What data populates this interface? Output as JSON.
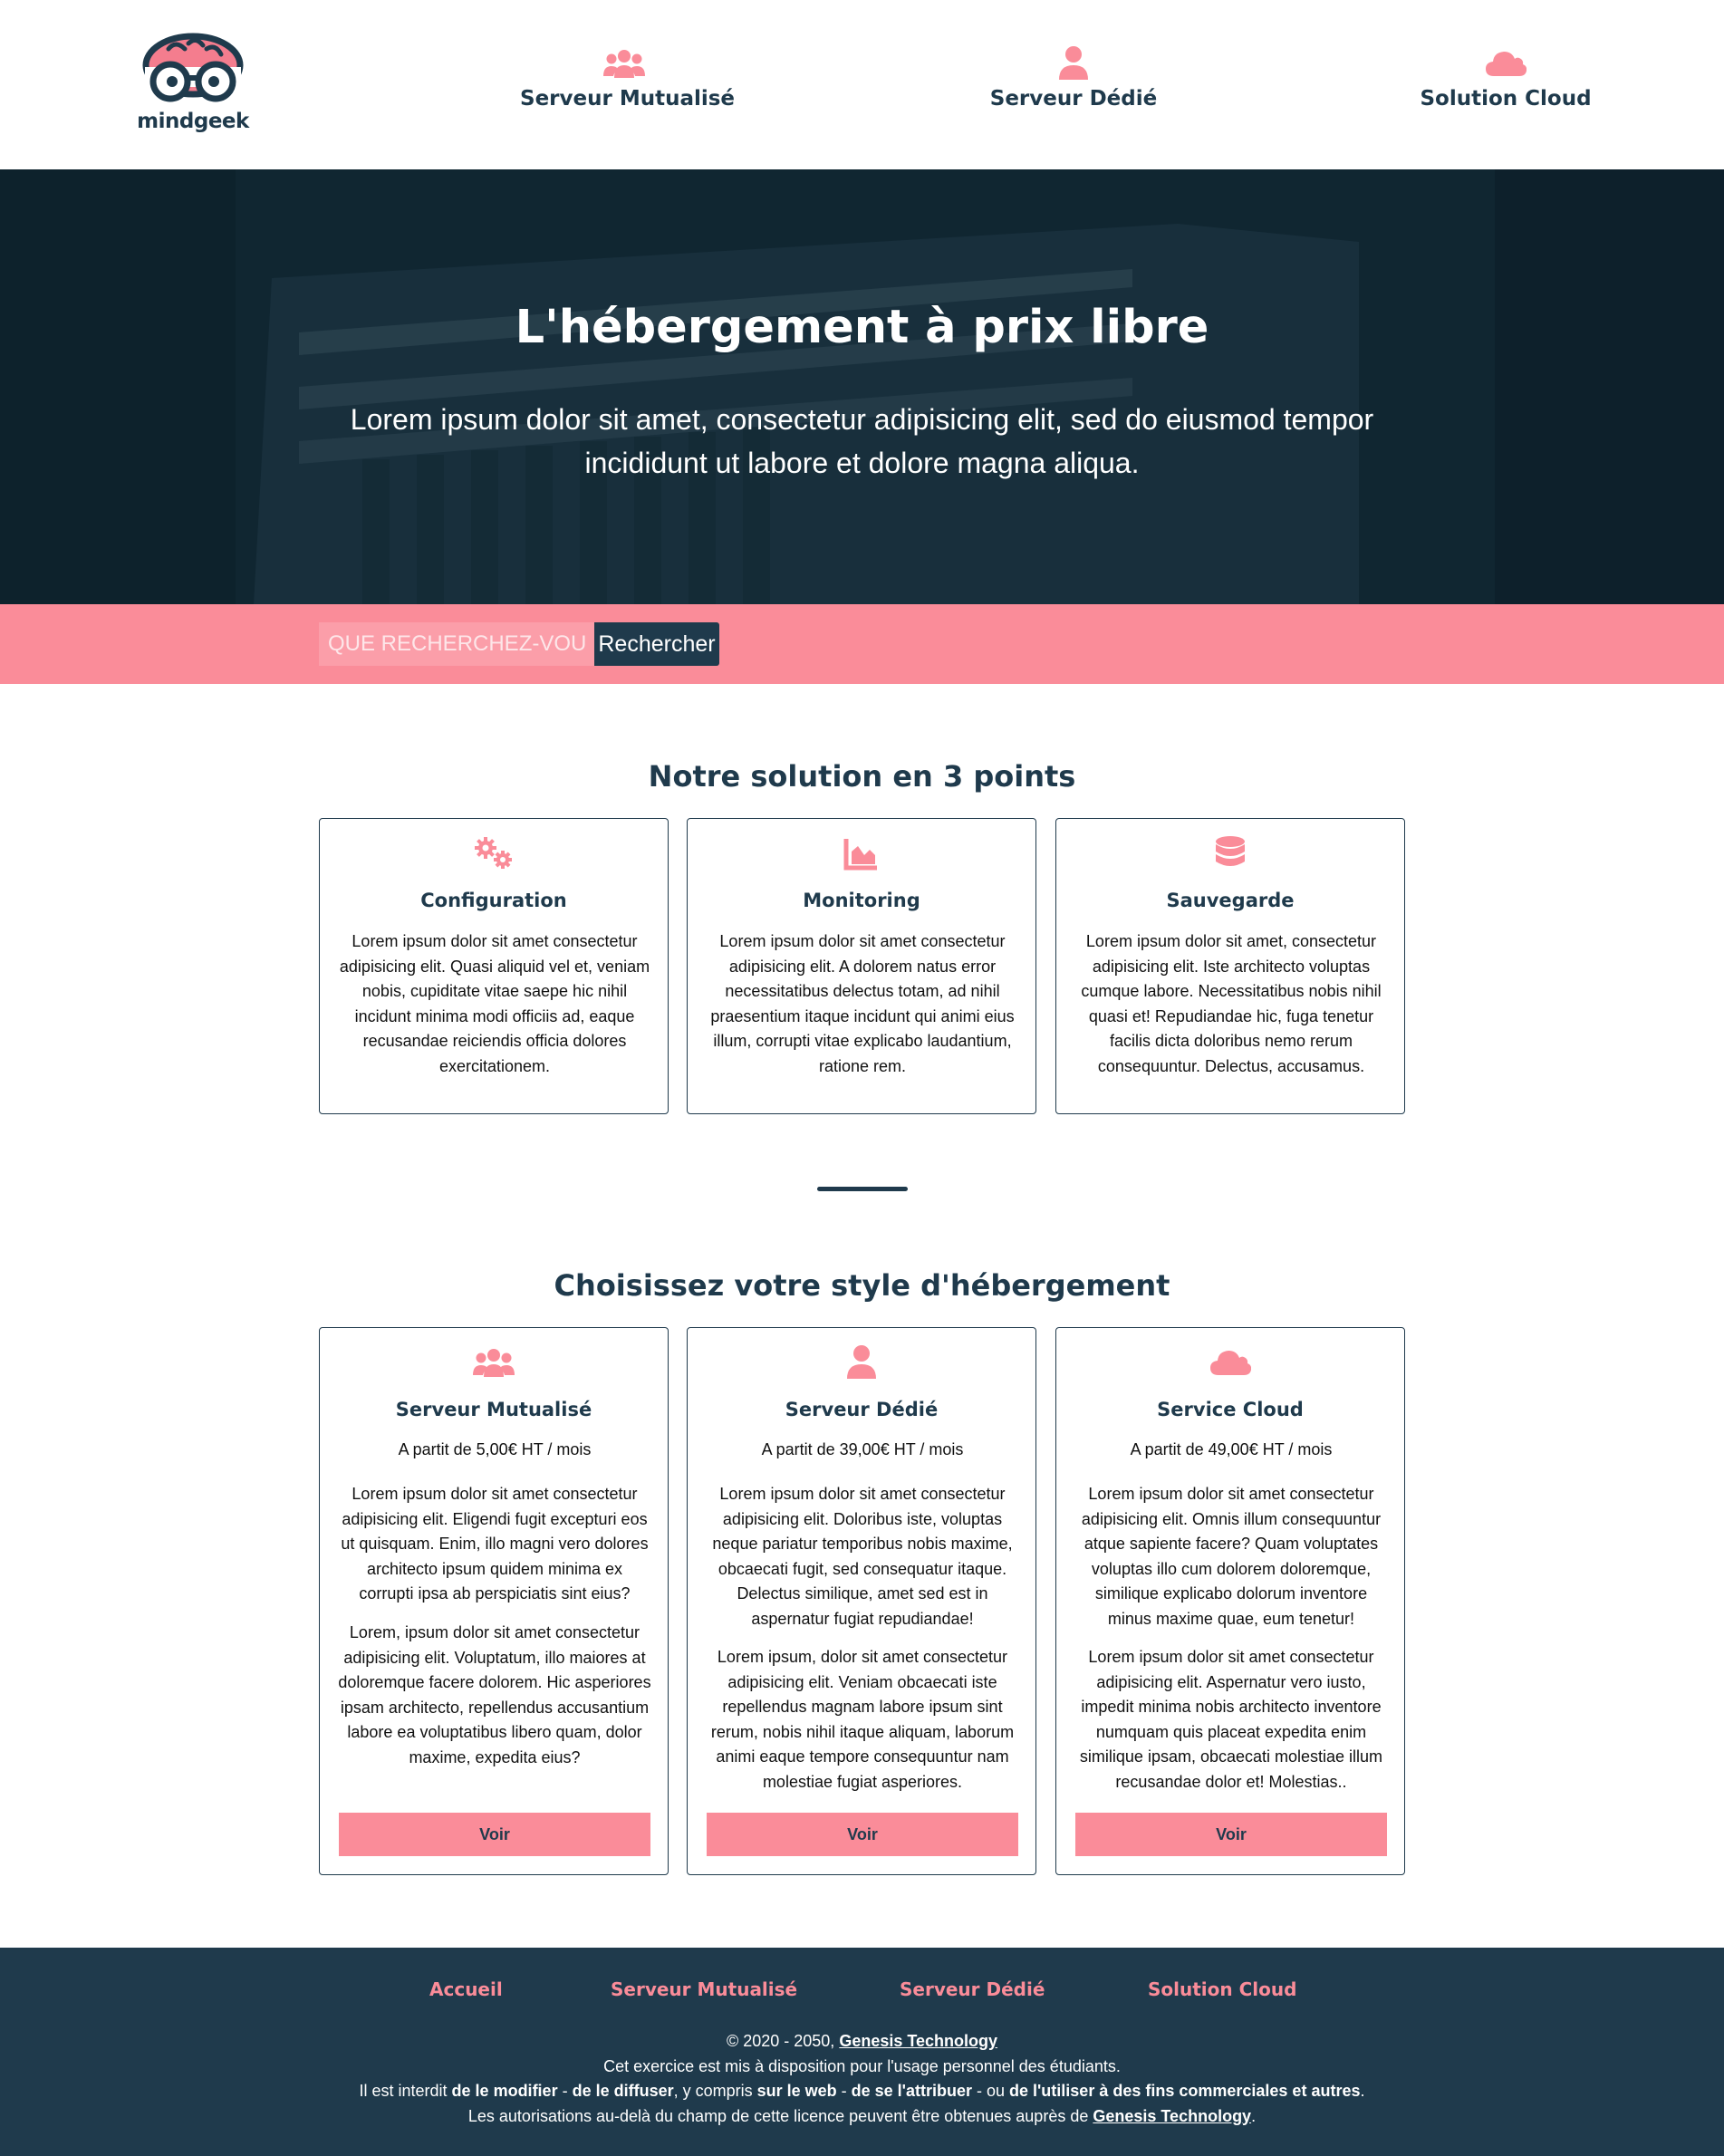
{
  "brand": {
    "name": "mindgeek",
    "primary": "#1f3a4c",
    "accent": "#fa8c99"
  },
  "nav": {
    "items": [
      {
        "label": "Serveur Mutualisé",
        "icon": "users-icon"
      },
      {
        "label": "Serveur Dédié",
        "icon": "user-icon"
      },
      {
        "label": "Solution Cloud",
        "icon": "cloud-icon"
      }
    ]
  },
  "hero": {
    "title": "L'hébergement à prix libre",
    "subtitle": "Lorem ipsum dolor sit amet, consectetur adipisicing elit, sed do eiusmod tempor incididunt ut labore et dolore magna aliqua."
  },
  "search": {
    "placeholder": "QUE RECHERCHEZ-VOUS ?",
    "button": "Rechercher"
  },
  "features": {
    "title": "Notre solution en 3 points",
    "cards": [
      {
        "icon": "gears-icon",
        "title": "Configuration",
        "text": "Lorem ipsum dolor sit amet consectetur adipisicing elit. Quasi aliquid vel et, veniam nobis, cupiditate vitae saepe hic nihil incidunt minima modi officiis ad, eaque recusandae reiciendis officia dolores exercitationem."
      },
      {
        "icon": "chart-area-icon",
        "title": "Monitoring",
        "text": "Lorem ipsum dolor sit amet consectetur adipisicing elit. A dolorem natus error necessitatibus delectus totam, ad nihil praesentium itaque incidunt qui animi eius illum, corrupti vitae explicabo laudantium, ratione rem."
      },
      {
        "icon": "database-icon",
        "title": "Sauvegarde",
        "text": "Lorem ipsum dolor sit amet, consectetur adipisicing elit. Iste architecto voluptas cumque labore. Necessitatibus nobis nihil quasi et! Repudiandae hic, fuga tenetur facilis dicta doloribus nemo rerum consequuntur. Delectus, accusamus."
      }
    ]
  },
  "offers": {
    "title": "Choisissez votre style d'hébergement",
    "cards": [
      {
        "icon": "users-icon",
        "title": "Serveur Mutualisé",
        "price": "A partit de 5,00€ HT / mois",
        "p1": "Lorem ipsum dolor sit amet consectetur adipisicing elit. Eligendi fugit excepturi eos ut quisquam. Enim, illo magni vero dolores architecto ipsum quidem minima ex corrupti ipsa ab perspiciatis sint eius?",
        "p2": "Lorem, ipsum dolor sit amet consectetur adipisicing elit. Voluptatum, illo maiores at doloremque facere dolorem. Hic asperiores ipsam architecto, repellendus accusantium labore ea voluptatibus libero quam, dolor maxime, expedita eius?",
        "button": "Voir"
      },
      {
        "icon": "user-icon",
        "title": "Serveur Dédié",
        "price": "A partit de 39,00€ HT / mois",
        "p1": "Lorem ipsum dolor sit amet consectetur adipisicing elit. Doloribus iste, voluptas neque pariatur temporibus nobis maxime, obcaecati fugit, sed consequatur itaque. Delectus similique, amet sed est in aspernatur fugiat repudiandae!",
        "p2": "Lorem ipsum, dolor sit amet consectetur adipisicing elit. Veniam obcaecati iste repellendus magnam labore ipsum sint rerum, nobis nihil itaque aliquam, laborum animi eaque tempore consequuntur nam molestiae fugiat asperiores.",
        "button": "Voir"
      },
      {
        "icon": "cloud-icon",
        "title": "Service Cloud",
        "price": "A partit de 49,00€ HT / mois",
        "p1": "Lorem ipsum dolor sit amet consectetur adipisicing elit. Omnis illum consequuntur atque sapiente facere? Quam voluptates voluptas illo cum dolorem doloremque, similique explicabo dolorum inventore minus maxime quae, eum tenetur!",
        "p2": "Lorem ipsum dolor sit amet consectetur adipisicing elit. Aspernatur vero iusto, impedit minima nobis architecto inventore numquam quis placeat expedita enim similique ipsam, obcaecati molestiae illum recusandae dolor et! Molestias..",
        "button": "Voir"
      }
    ]
  },
  "footer": {
    "links": [
      "Accueil",
      "Serveur Mutualisé",
      "Serveur Dédié",
      "Solution Cloud"
    ],
    "copyright_prefix": "© 2020 - 2050, ",
    "company": "Genesis Technology",
    "line2": "Cet exercice est mis à disposition pour l'usage personnel des étudiants.",
    "line3": {
      "t1": "Il est interdit ",
      "b1": "de le modifier",
      "t2": " - ",
      "b2": "de le diffuser",
      "t3": ", y compris ",
      "b3": "sur le web",
      "t4": " - ",
      "b4": "de se l'attribuer",
      "t5": " - ou ",
      "b5": "de l'utiliser à des fins commerciales et autres",
      "t6": "."
    },
    "line4_prefix": "Les autorisations au-delà du champ de cette licence peuvent être obtenues auprès de ",
    "line4_suffix": "."
  }
}
